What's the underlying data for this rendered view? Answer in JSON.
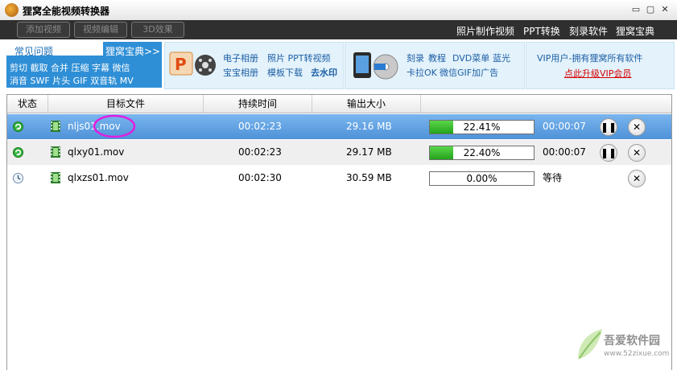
{
  "window": {
    "title": "狸窝全能视频转换器",
    "controls": [
      "▭",
      "▢",
      "✕"
    ]
  },
  "toolbar": {
    "buttons": [
      "添加视频",
      "视频编辑",
      "3D效果"
    ],
    "links": [
      "照片制作视频",
      "PPT转换",
      "刻录软件",
      "狸窝宝典"
    ]
  },
  "banner": {
    "faq": {
      "title": "常见问题",
      "more": "狸窝宝典>>",
      "line1": "剪切 截取 合并 压缩 字幕 微信",
      "line2": "消音 SWF 片头 GIF 双音轨 MV"
    },
    "panel1": {
      "row1": [
        "电子相册",
        "照片 PPT转视频"
      ],
      "row2": [
        "宝宝相册",
        "模板下载",
        "去水印"
      ]
    },
    "panel2": {
      "row1": [
        "刻录",
        "教程",
        "DVD菜单",
        "蓝光"
      ],
      "row2": [
        "卡拉OK",
        "微信GIF加广告"
      ]
    },
    "vip": {
      "line1": "VIP用户-拥有狸窝所有软件",
      "line2": "点此升级VIP会员"
    },
    "colors": {
      "faq_bg": "#2f8fd6",
      "link": "#1d5fa5",
      "vip_link": "#d40000"
    }
  },
  "table": {
    "headers": [
      "状态",
      "目标文件",
      "持续时间",
      "输出大小"
    ],
    "rows": [
      {
        "file": "nljs01.mov",
        "duration": "00:02:23",
        "size": "29.16 MB",
        "progress": "22.41%",
        "progress_value": 0.2241,
        "time": "00:00:07",
        "status_icon": "converting-icon",
        "selected": true
      },
      {
        "file": "qlxy01.mov",
        "duration": "00:02:23",
        "size": "29.17 MB",
        "progress": "22.40%",
        "progress_value": 0.224,
        "time": "00:00:07",
        "status_icon": "converting-icon",
        "selected": false
      },
      {
        "file": "qlxzs01.mov",
        "duration": "00:02:30",
        "size": "30.59 MB",
        "progress": "0.00%",
        "progress_value": 0.0,
        "time": "等待",
        "status_icon": "clock-icon",
        "selected": false
      }
    ],
    "colors": {
      "selected_row": "#5ea2e6",
      "alt_row": "#efefef",
      "progress_fill": "#2fb526"
    }
  },
  "watermark": {
    "line1": "吾爱软件园",
    "line2": "www.52zixue.com"
  }
}
